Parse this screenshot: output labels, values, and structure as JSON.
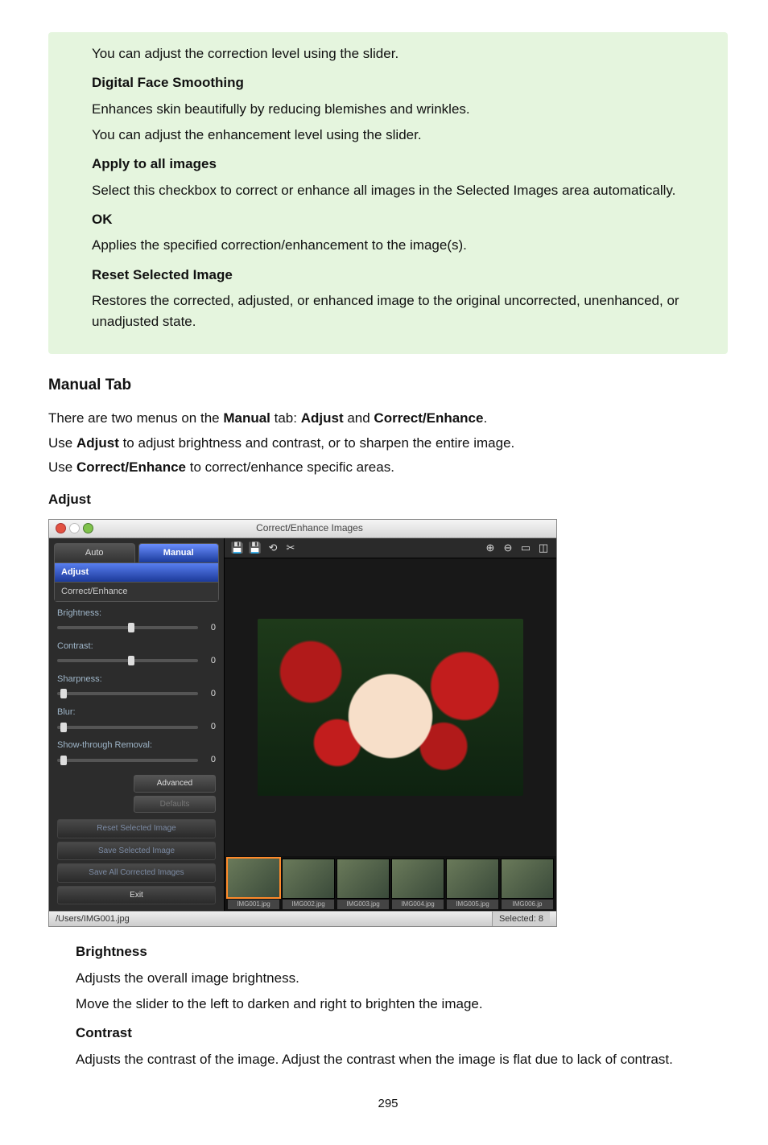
{
  "green": {
    "line1": "You can adjust the correction level using the slider.",
    "h_dfs": "Digital Face Smoothing",
    "dfs_p1": "Enhances skin beautifully by reducing blemishes and wrinkles.",
    "dfs_p2": "You can adjust the enhancement level using the slider.",
    "h_apply": "Apply to all images",
    "apply_p": "Select this checkbox to correct or enhance all images in the Selected Images area automatically.",
    "h_ok": "OK",
    "ok_p": "Applies the specified correction/enhancement to the image(s).",
    "h_reset": "Reset Selected Image",
    "reset_p": "Restores the corrected, adjusted, or enhanced image to the original uncorrected, unenhanced, or unadjusted state."
  },
  "heading_manual": "Manual Tab",
  "manual_intro": {
    "p1_a": "There are two menus on the ",
    "p1_b": "Manual",
    "p1_c": " tab: ",
    "p1_d": "Adjust",
    "p1_e": " and ",
    "p1_f": "Correct/Enhance",
    "p1_g": ".",
    "p2_a": "Use ",
    "p2_b": "Adjust",
    "p2_c": " to adjust brightness and contrast, or to sharpen the entire image.",
    "p3_a": "Use ",
    "p3_b": "Correct/Enhance",
    "p3_c": " to correct/enhance specific areas."
  },
  "heading_adjust": "Adjust",
  "shot": {
    "window_title": "Correct/Enhance Images",
    "tab_auto": "Auto",
    "tab_manual": "Manual",
    "subtab_adjust": "Adjust",
    "subtab_ce": "Correct/Enhance",
    "sliders": [
      {
        "label": "Brightness:",
        "value": "0",
        "pos": 50
      },
      {
        "label": "Contrast:",
        "value": "0",
        "pos": 50
      },
      {
        "label": "Sharpness:",
        "value": "0",
        "pos": 2
      },
      {
        "label": "Blur:",
        "value": "0",
        "pos": 2
      },
      {
        "label": "Show-through Removal:",
        "value": "0",
        "pos": 2
      }
    ],
    "btn_advanced": "Advanced",
    "btn_defaults": "Defaults",
    "btn_reset": "Reset Selected Image",
    "btn_save": "Save Selected Image",
    "btn_saveall": "Save All Corrected Images",
    "btn_exit": "Exit",
    "thumbs": [
      "IMG001.jpg",
      "IMG002.jpg",
      "IMG003.jpg",
      "IMG004.jpg",
      "IMG005.jpg",
      "IMG006.jp"
    ],
    "status_path": "/Users/IMG001.jpg",
    "status_selected": "Selected: 8"
  },
  "after": {
    "h_brightness": "Brightness",
    "br_p1": "Adjusts the overall image brightness.",
    "br_p2": "Move the slider to the left to darken and right to brighten the image.",
    "h_contrast": "Contrast",
    "ct_p": "Adjusts the contrast of the image. Adjust the contrast when the image is flat due to lack of contrast."
  },
  "page_number": "295"
}
